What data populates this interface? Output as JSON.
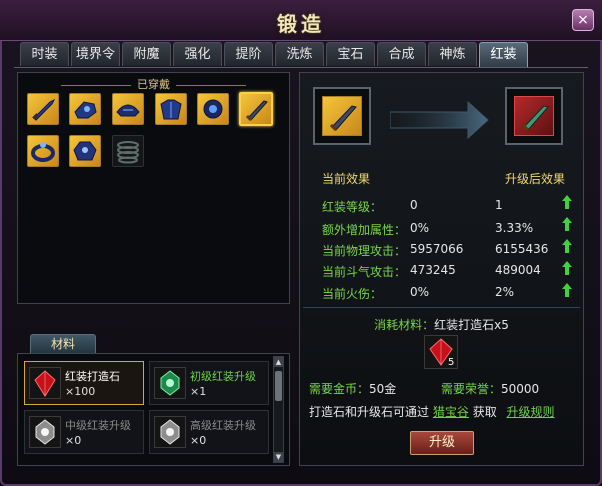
{
  "window": {
    "title": "锻造",
    "close_label": "×"
  },
  "tabs": [
    {
      "label": "时装"
    },
    {
      "label": "境界令"
    },
    {
      "label": "附魔"
    },
    {
      "label": "强化"
    },
    {
      "label": "提阶"
    },
    {
      "label": "洗炼"
    },
    {
      "label": "宝石"
    },
    {
      "label": "合成"
    },
    {
      "label": "神炼"
    },
    {
      "label": "红装",
      "active": true
    }
  ],
  "equipment": {
    "title": "已穿戴",
    "items": [
      {
        "icon": "sword-icon",
        "selected": false
      },
      {
        "icon": "gauntlet-icon",
        "selected": false
      },
      {
        "icon": "helmet-icon",
        "selected": false
      },
      {
        "icon": "armor-icon",
        "selected": false
      },
      {
        "icon": "amulet-icon",
        "selected": false
      },
      {
        "icon": "blade-icon",
        "selected": true
      },
      {
        "icon": "ring-icon",
        "selected": false
      },
      {
        "icon": "shoulder-icon",
        "selected": false
      },
      {
        "icon": "boots-icon",
        "selected": false,
        "empty": true
      }
    ]
  },
  "materials": {
    "tab_label": "材料",
    "items": [
      {
        "name": "红装打造石",
        "count": "×100",
        "color": "#ffffff",
        "selected": true,
        "gem": "red-gem-icon"
      },
      {
        "name": "初级红装升级",
        "count": "×1",
        "color": "#6fd24a",
        "selected": false,
        "gem": "green-gem-icon"
      },
      {
        "name": "中级红装升级",
        "count": "×0",
        "color": "#8a8a8a",
        "selected": false,
        "gem": "white-gem-icon"
      },
      {
        "name": "高级红装升级",
        "count": "×0",
        "color": "#8a8a8a",
        "selected": false,
        "gem": "white-gem-icon"
      }
    ]
  },
  "upgrade": {
    "current_label": "当前效果",
    "after_label": "升级后效果",
    "stats": [
      {
        "key": "红装等级：",
        "current": "0",
        "after": "1"
      },
      {
        "key": "额外增加属性：",
        "current": "0%",
        "after": "3.33%"
      },
      {
        "key": "当前物理攻击：",
        "current": "5957066",
        "after": "6155436"
      },
      {
        "key": "当前斗气攻击：",
        "current": "473245",
        "after": "489004"
      },
      {
        "key": "当前火伤：",
        "current": "0%",
        "after": "2%"
      }
    ],
    "consume_label": "消耗材料：",
    "consume_item": "红装打造石x5",
    "consume_count": "5",
    "gold_label": "需要金币：",
    "gold_value": "50金",
    "honor_label": "需要荣誉：",
    "honor_value": "50000",
    "hint_prefix": "打造石和升级石可通过",
    "hint_link": "猎宝谷",
    "hint_suffix": "获取",
    "rules_link": "升级规则",
    "button_label": "升级"
  },
  "colors": {
    "accent_green": "#78d64a",
    "gold": "#f0d870",
    "frame": "#5a3a6a"
  }
}
